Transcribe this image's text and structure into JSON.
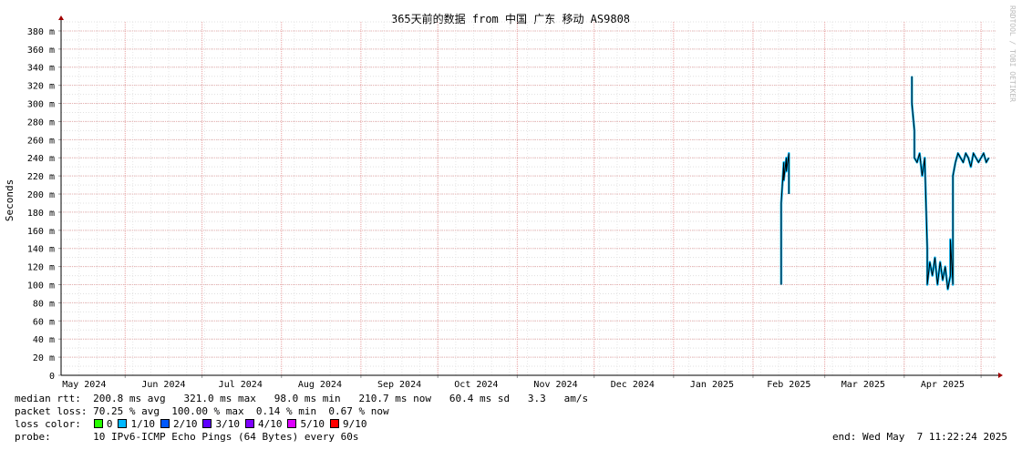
{
  "chart_data": {
    "type": "line",
    "title": "365天前的数据 from 中国 广东 移动 AS9808",
    "ylabel": "Seconds",
    "watermark": "RRDTOOL / TOBI OETIKER",
    "ylim": [
      0,
      0.39
    ],
    "yticks": [
      {
        "v": 0,
        "label": "0"
      },
      {
        "v": 0.02,
        "label": "20 m"
      },
      {
        "v": 0.04,
        "label": "40 m"
      },
      {
        "v": 0.06,
        "label": "60 m"
      },
      {
        "v": 0.08,
        "label": "80 m"
      },
      {
        "v": 0.1,
        "label": "100 m"
      },
      {
        "v": 0.12,
        "label": "120 m"
      },
      {
        "v": 0.14,
        "label": "140 m"
      },
      {
        "v": 0.16,
        "label": "160 m"
      },
      {
        "v": 0.18,
        "label": "180 m"
      },
      {
        "v": 0.2,
        "label": "200 m"
      },
      {
        "v": 0.22,
        "label": "220 m"
      },
      {
        "v": 0.24,
        "label": "240 m"
      },
      {
        "v": 0.26,
        "label": "260 m"
      },
      {
        "v": 0.28,
        "label": "280 m"
      },
      {
        "v": 0.3,
        "label": "300 m"
      },
      {
        "v": 0.32,
        "label": "320 m"
      },
      {
        "v": 0.34,
        "label": "340 m"
      },
      {
        "v": 0.36,
        "label": "360 m"
      },
      {
        "v": 0.38,
        "label": "380 m"
      }
    ],
    "xlim": [
      "2024-05-07",
      "2025-05-07"
    ],
    "month_starts": [
      "2024-05-01",
      "2024-06-01",
      "2024-07-01",
      "2024-08-01",
      "2024-09-01",
      "2024-10-01",
      "2024-11-01",
      "2024-12-01",
      "2025-01-01",
      "2025-02-01",
      "2025-03-01",
      "2025-04-01",
      "2025-05-01"
    ],
    "month_labels": [
      {
        "date": "2024-05-16",
        "label": "May 2024"
      },
      {
        "date": "2024-06-16",
        "label": "Jun 2024"
      },
      {
        "date": "2024-07-16",
        "label": "Jul 2024"
      },
      {
        "date": "2024-08-16",
        "label": "Aug 2024"
      },
      {
        "date": "2024-09-16",
        "label": "Sep 2024"
      },
      {
        "date": "2024-10-16",
        "label": "Oct 2024"
      },
      {
        "date": "2024-11-16",
        "label": "Nov 2024"
      },
      {
        "date": "2024-12-16",
        "label": "Dec 2024"
      },
      {
        "date": "2025-01-16",
        "label": "Jan 2025"
      },
      {
        "date": "2025-02-15",
        "label": "Feb 2025"
      },
      {
        "date": "2025-03-16",
        "label": "Mar 2025"
      },
      {
        "date": "2025-04-16",
        "label": "Apr 2025"
      }
    ],
    "series": [
      {
        "loss_color": "#00bbff",
        "points": [
          [
            "2025-02-12",
            0.1
          ],
          [
            "2025-02-12",
            0.19
          ],
          [
            "2025-02-13",
            0.235
          ],
          [
            "2025-02-13",
            0.215
          ],
          [
            "2025-02-14",
            0.24
          ],
          [
            "2025-02-14",
            0.225
          ],
          [
            "2025-02-15",
            0.245
          ],
          [
            "2025-02-15",
            0.2
          ]
        ]
      },
      {
        "loss_color": "#00bbff",
        "points": [
          [
            "2025-04-04",
            0.33
          ],
          [
            "2025-04-04",
            0.3
          ],
          [
            "2025-04-05",
            0.27
          ],
          [
            "2025-04-05",
            0.24
          ],
          [
            "2025-04-06",
            0.235
          ],
          [
            "2025-04-07",
            0.245
          ],
          [
            "2025-04-08",
            0.22
          ],
          [
            "2025-04-09",
            0.24
          ],
          [
            "2025-04-10",
            0.14
          ],
          [
            "2025-04-10",
            0.1
          ],
          [
            "2025-04-11",
            0.125
          ],
          [
            "2025-04-12",
            0.11
          ],
          [
            "2025-04-13",
            0.13
          ],
          [
            "2025-04-14",
            0.1
          ],
          [
            "2025-04-15",
            0.125
          ],
          [
            "2025-04-16",
            0.105
          ],
          [
            "2025-04-17",
            0.12
          ],
          [
            "2025-04-18",
            0.095
          ],
          [
            "2025-04-19",
            0.11
          ],
          [
            "2025-04-19",
            0.15
          ],
          [
            "2025-04-20",
            0.1
          ],
          [
            "2025-04-20",
            0.22
          ],
          [
            "2025-04-21",
            0.235
          ],
          [
            "2025-04-22",
            0.245
          ],
          [
            "2025-04-23",
            0.24
          ],
          [
            "2025-04-24",
            0.235
          ],
          [
            "2025-04-25",
            0.245
          ],
          [
            "2025-04-26",
            0.24
          ],
          [
            "2025-04-27",
            0.23
          ],
          [
            "2025-04-28",
            0.245
          ],
          [
            "2025-04-29",
            0.24
          ],
          [
            "2025-04-30",
            0.235
          ],
          [
            "2025-05-01",
            0.24
          ],
          [
            "2025-05-02",
            0.245
          ],
          [
            "2025-05-03",
            0.235
          ],
          [
            "2025-05-04",
            0.24
          ]
        ]
      }
    ],
    "grid": true
  },
  "stats": {
    "median_rtt_label": "median rtt:",
    "median_rtt_values": "200.8 ms avg   321.0 ms max   98.0 ms min   210.7 ms now   60.4 ms sd   3.3   am/s",
    "packet_loss_label": "packet loss:",
    "packet_loss_values": "70.25 % avg  100.00 % max  0.14 % min  0.67 % now",
    "loss_color_label": "loss color:",
    "loss_colors": [
      {
        "label": "0",
        "color": "#26ff00"
      },
      {
        "label": "1/10",
        "color": "#00b8ff"
      },
      {
        "label": "2/10",
        "color": "#0059ff"
      },
      {
        "label": "3/10",
        "color": "#5e00ff"
      },
      {
        "label": "4/10",
        "color": "#7e00ff"
      },
      {
        "label": "5/10",
        "color": "#dd00ff"
      },
      {
        "label": "9/10",
        "color": "#ff0000"
      }
    ],
    "probe_label": "probe:",
    "probe_value": "10 IPv6-ICMP Echo Pings (64 Bytes) every 60s",
    "end_text": "end: Wed May  7 11:22:24 2025"
  }
}
